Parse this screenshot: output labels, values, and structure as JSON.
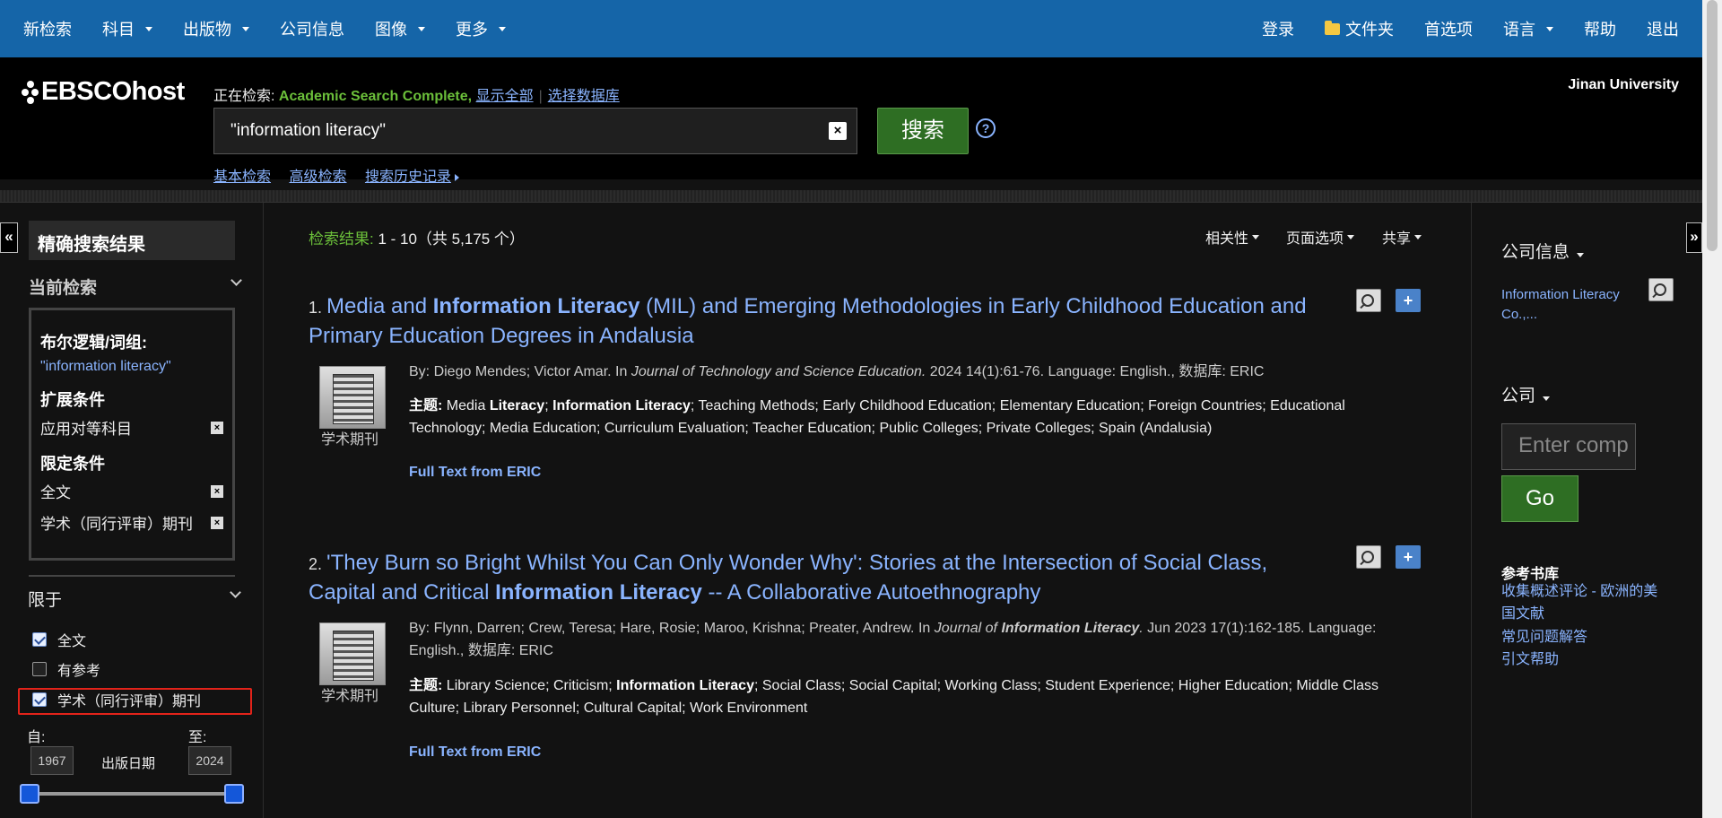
{
  "topnav": {
    "left": [
      {
        "label": "新检索",
        "caret": false
      },
      {
        "label": "科目",
        "caret": true
      },
      {
        "label": "出版物",
        "caret": true
      },
      {
        "label": "公司信息",
        "caret": false
      },
      {
        "label": "图像",
        "caret": true
      },
      {
        "label": "更多",
        "caret": true
      }
    ],
    "right": {
      "login": "登录",
      "folder": "文件夹",
      "preferences": "首选项",
      "language": "语言",
      "help": "帮助",
      "logout": "退出"
    }
  },
  "header": {
    "logo": "EBSCOhost",
    "searching_label": "正在检索:",
    "database": "Academic Search Complete,",
    "show_all": "显示全部",
    "choose_db": "选择数据库",
    "query": "\"information literacy\"",
    "clear": "×",
    "search_button": "搜索",
    "help": "?",
    "basic_search": "基本检索",
    "advanced_search": "高级检索",
    "history": "搜索历史记录",
    "institution": "Jinan University"
  },
  "left": {
    "collapse": "«",
    "title": "精确搜索结果",
    "current_search": "当前检索",
    "boolean_label": "布尔逻辑/词组:",
    "boolean_value": "\"information literacy\"",
    "expanders_label": "扩展条件",
    "expander_item": "应用对等科目",
    "limiters_label": "限定条件",
    "limiter_fulltext": "全文",
    "limiter_peer": "学术（同行评审）期刊",
    "limit_to": "限于",
    "cb_fulltext": "全文",
    "cb_references": "有参考",
    "cb_peer": "学术（同行评审）期刊",
    "from": "自:",
    "to": "至:",
    "from_year": "1967",
    "to_year": "2024",
    "pub_date": "出版日期",
    "x": "×"
  },
  "main": {
    "results_label": "检索结果:",
    "results_range": " 1 - 10（共 5,175 个）",
    "relevance": "相关性",
    "page_options": "页面选项",
    "share": "共享",
    "results": [
      {
        "num": "1.",
        "title_parts": [
          [
            "Media and ",
            false
          ],
          [
            "Information Literacy",
            true
          ],
          [
            " (MIL) and Emerging Methodologies in Early Childhood Education and Primary Education Degrees in Andalusia",
            false
          ]
        ],
        "pubtype": "学术期刊",
        "meta_html": "By: Diego Mendes; Victor Amar. In <i>Journal of Technology and Science Education.</i> 2024 14(1):61-76. Language: English., 数据库: ERIC",
        "subjects_html": "<b>主题:</b> Media <b>Literacy</b>; <b>Information Literacy</b>; Teaching Methods; Early Childhood Education; Elementary Education; Foreign Countries; Educational Technology; Media Education; Curriculum Evaluation; Teacher Education; Public Colleges; Private Colleges; Spain (Andalusia)",
        "fulltext": "Full Text from ERIC"
      },
      {
        "num": "2.",
        "title_parts": [
          [
            "'They Burn so Bright Whilst You Can Only Wonder Why': Stories at the Intersection of Social Class, Capital and Critical ",
            false
          ],
          [
            "Information Literacy",
            true
          ],
          [
            " -- A Collaborative Autoethnography",
            false
          ]
        ],
        "pubtype": "学术期刊",
        "meta_html": "By: Flynn, Darren; Crew, Teresa; Hare, Rosie; Maroo, Krishna; Preater, Andrew. In <i>Journal of <b>Information Literacy</b>.</i> Jun 2023 17(1):162-185. Language: English., 数据库: ERIC",
        "subjects_html": "<b>主题:</b> Library Science; Criticism; <b>Information Literacy</b>; Social Class; Social Capital; Working Class; Student Experience; Higher Education; Middle Class Culture; Library Personnel; Cultural Capital; Work Environment",
        "fulltext": "Full Text from ERIC"
      }
    ]
  },
  "right": {
    "collapse": "»",
    "company_info": "公司信息",
    "company_link": "Information Literacy Co.,...",
    "company": "公司",
    "company_placeholder": "Enter comp",
    "go": "Go",
    "reference_title": "参考书库",
    "ref_link1": "收集概述评论 - 欧洲的美国文献",
    "ref_link2": "常见问题解答",
    "ref_link3": "引文帮助"
  },
  "colors": {
    "nav_blue": "#1565a8",
    "link": "#8ab4ff",
    "green": "#6bbf3a",
    "highlight_red": "#e2231a"
  }
}
